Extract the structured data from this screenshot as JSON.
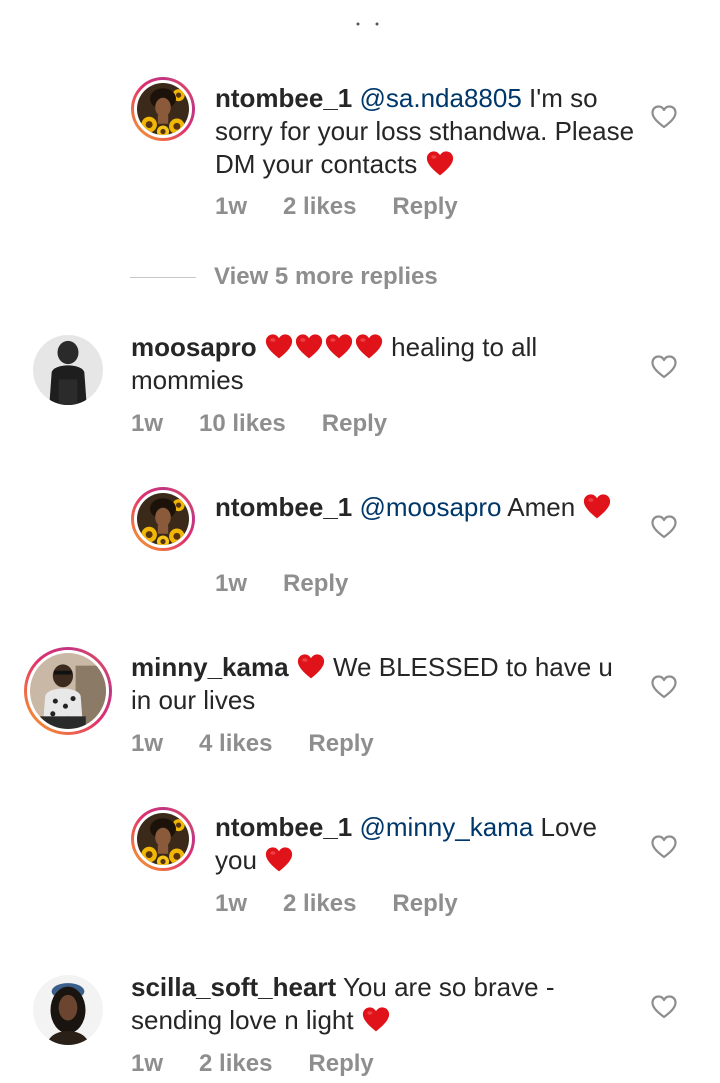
{
  "comments": [
    {
      "id": "c1",
      "username": "ntombee_1",
      "mention": "@sa.nda8805",
      "text": " I'm so sorry for your loss sthandwa. Please DM your contacts ",
      "time": "1w",
      "likes": "2 likes",
      "reply": "Reply",
      "avatar": "ntombee-sunflower-avatar",
      "hearts": 1
    },
    {
      "id": "c2",
      "username": "moosapro",
      "text": " healing to all mommies",
      "time": "1w",
      "likes": "10 likes",
      "reply": "Reply",
      "avatar": "moosapro-avatar",
      "hearts": 4
    },
    {
      "id": "c3",
      "username": "ntombee_1",
      "mention": "@moosapro",
      "text": " Amen ",
      "time": "1w",
      "reply": "Reply",
      "avatar": "ntombee-sunflower-avatar",
      "hearts": 1
    },
    {
      "id": "c4",
      "username": "minny_kama",
      "text": " We BLESSED to have u in our lives",
      "time": "1w",
      "likes": "4 likes",
      "reply": "Reply",
      "avatar": "minny-kama-avatar",
      "hearts": 1
    },
    {
      "id": "c5",
      "username": "ntombee_1",
      "mention": "@minny_kama",
      "text": " Love you ",
      "time": "1w",
      "likes": "2 likes",
      "reply": "Reply",
      "avatar": "ntombee-sunflower-avatar",
      "hearts": 1
    },
    {
      "id": "c6",
      "username": "scilla_soft_heart",
      "text": " You are so brave - sending love n light ",
      "time": "1w",
      "likes": "2 likes",
      "reply": "Reply",
      "avatar": "scilla-avatar",
      "hearts": 1
    }
  ],
  "view_more": "View 5 more replies",
  "colors": {
    "heart": "#e0131a",
    "username": "#262626",
    "mention": "#00376b",
    "meta": "#8e8e8e",
    "ring_start": "#f9a825",
    "ring_end": "#c13584"
  },
  "icons": {
    "heart_emoji": "red-heart-icon",
    "like": "heart-outline-icon"
  }
}
